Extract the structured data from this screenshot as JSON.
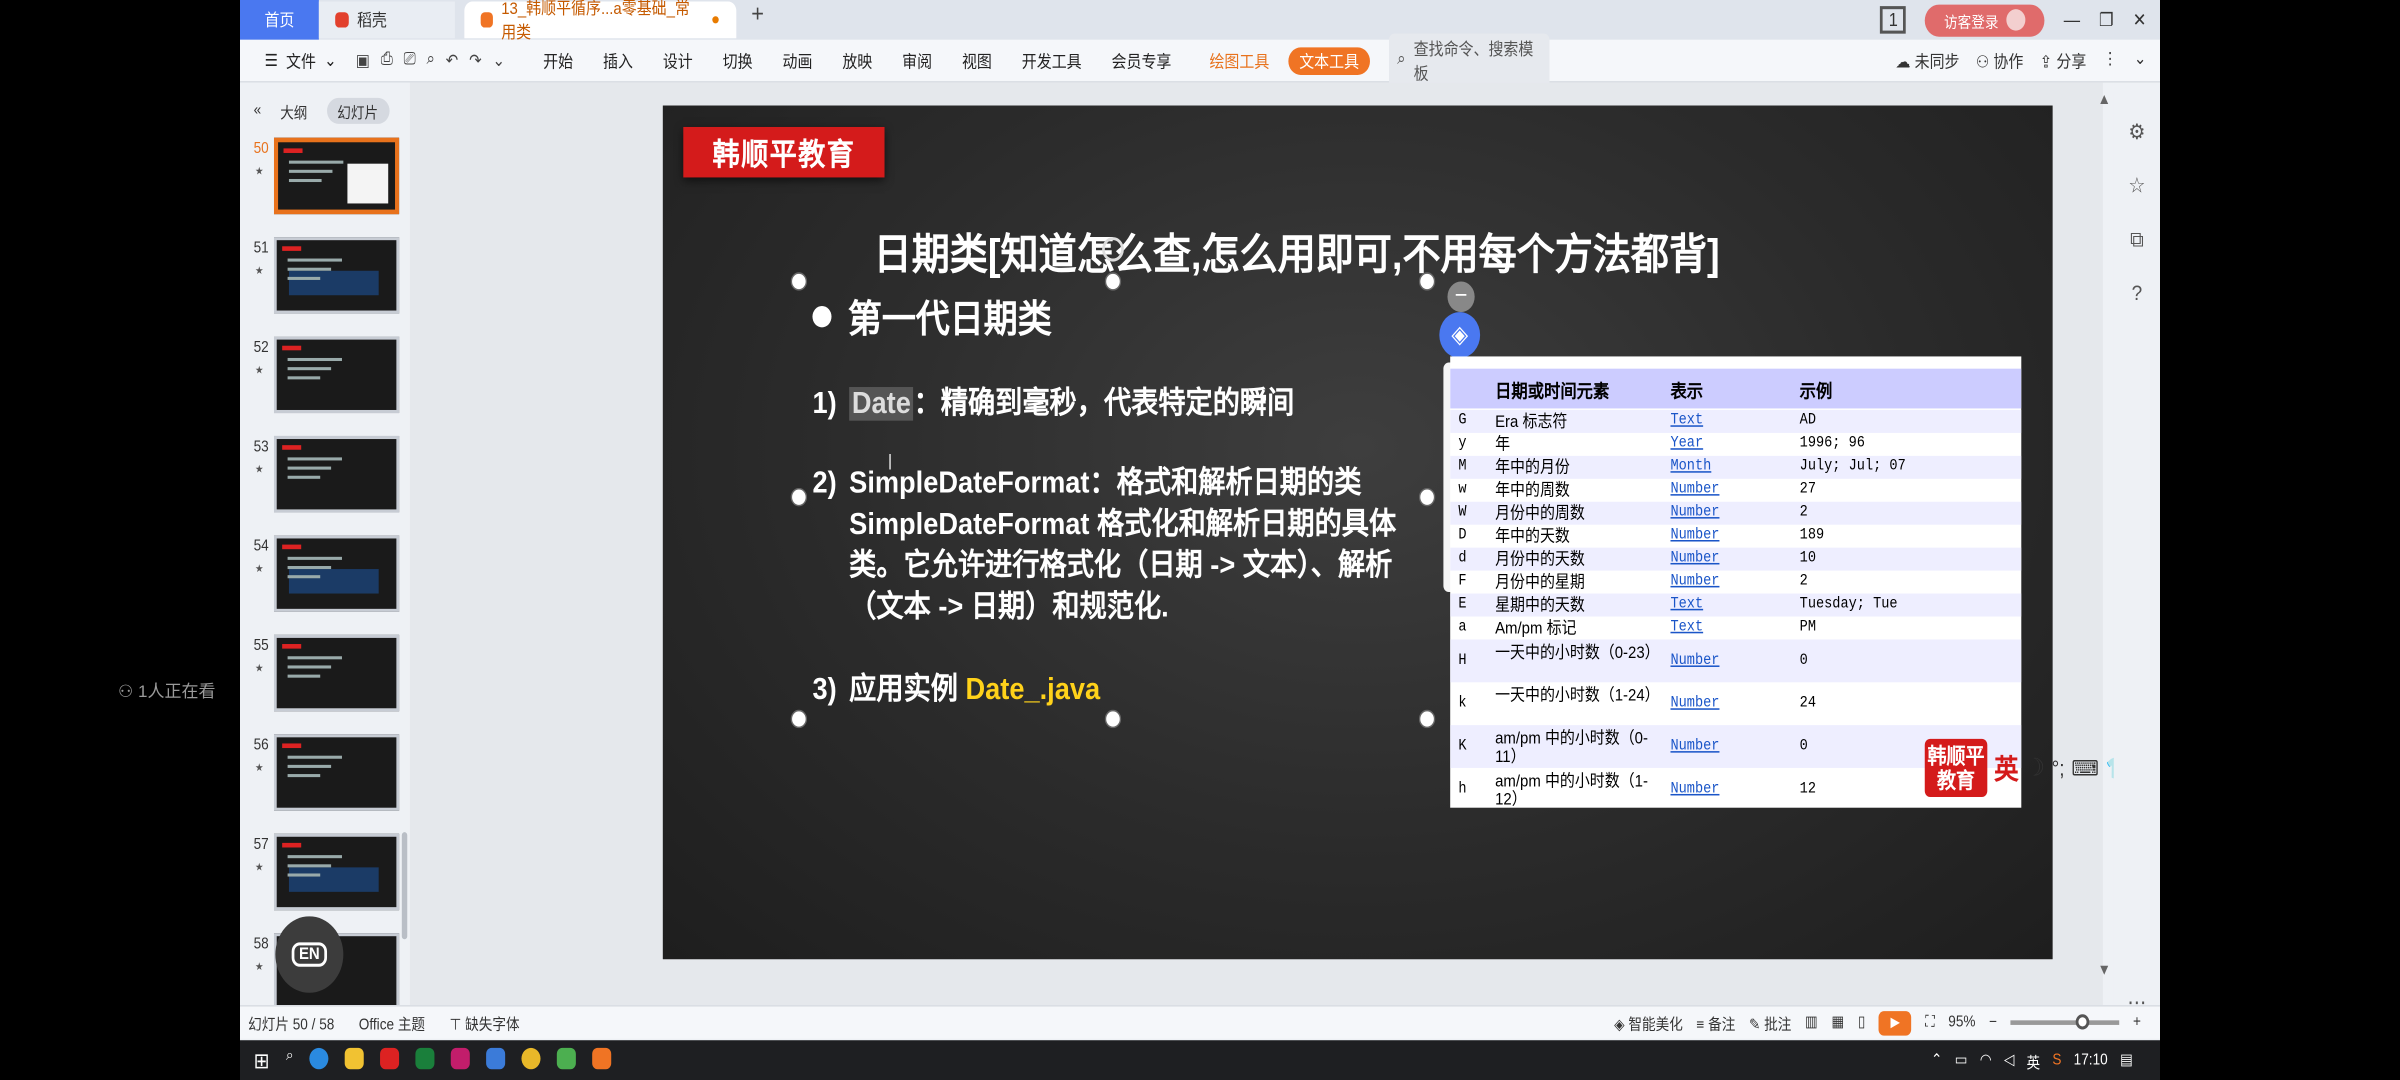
{
  "tabs": {
    "home": "首页",
    "daoke": "稻壳",
    "doc": "13_韩顺平循序...a零基础_常用类",
    "doc_dot": "●",
    "add": "+"
  },
  "window": {
    "badge": "1",
    "visitor_login": "访客登录",
    "min": "—",
    "max": "❐",
    "close": "✕"
  },
  "ribbon": {
    "file": "文件",
    "menu": [
      "开始",
      "插入",
      "设计",
      "切换",
      "动画",
      "放映",
      "审阅",
      "视图",
      "开发工具",
      "会员专享"
    ],
    "draw_tool": "绘图工具",
    "text_tool": "文本工具",
    "search_placeholder": "查找命令、搜索模板",
    "unsynced": "未同步",
    "collab": "协作",
    "share": "分享"
  },
  "leftpanel": {
    "outline": "大纲",
    "slides": "幻灯片",
    "thumb_numbers": [
      "50",
      "51",
      "52",
      "53",
      "54",
      "55",
      "56",
      "57",
      "58"
    ],
    "selected": "50",
    "en_button": "EN"
  },
  "slide": {
    "brand": "韩顺平教育",
    "title": "日期类[知道怎么查,怎么用即可,不用每个方法都背]",
    "heading": "第一代日期类",
    "items": [
      {
        "num": "1)",
        "highlight": "Date",
        "text": "：精确到毫秒，代表特定的瞬间"
      },
      {
        "num": "2)",
        "text": "SimpleDateFormat：格式和解析日期的类 SimpleDateFormat 格式化和解析日期的具体类。它允许进行格式化（日期 -> 文本）、解析（文本 -> 日期）和规范化."
      },
      {
        "num": "3)",
        "text": "应用实例 ",
        "yellow": "Date_.java"
      }
    ]
  },
  "table": {
    "headers": [
      "日期或时间元素",
      "表示",
      "示例"
    ],
    "rows": [
      {
        "letter": "G",
        "element": "Era 标志符",
        "type": "Text",
        "example": "AD"
      },
      {
        "letter": "y",
        "element": "年",
        "type": "Year",
        "example": "1996; 96"
      },
      {
        "letter": "M",
        "element": "年中的月份",
        "type": "Month",
        "example": "July; Jul; 07"
      },
      {
        "letter": "w",
        "element": "年中的周数",
        "type": "Number",
        "example": "27"
      },
      {
        "letter": "W",
        "element": "月份中的周数",
        "type": "Number",
        "example": "2"
      },
      {
        "letter": "D",
        "element": "年中的天数",
        "type": "Number",
        "example": "189"
      },
      {
        "letter": "d",
        "element": "月份中的天数",
        "type": "Number",
        "example": "10"
      },
      {
        "letter": "F",
        "element": "月份中的星期",
        "type": "Number",
        "example": "2"
      },
      {
        "letter": "E",
        "element": "星期中的天数",
        "type": "Text",
        "example": "Tuesday; Tue"
      },
      {
        "letter": "a",
        "element": "Am/pm 标记",
        "type": "Text",
        "example": "PM"
      },
      {
        "letter": "H",
        "element": "一天中的小时数（0-23）",
        "type": "Number",
        "example": "0"
      },
      {
        "letter": "k",
        "element": "一天中的小时数（1-24）",
        "type": "Number",
        "example": "24"
      },
      {
        "letter": "K",
        "element": "am/pm 中的小时数（0-11）",
        "type": "Number",
        "example": "0"
      },
      {
        "letter": "h",
        "element": "am/pm 中的小时数（1-12）",
        "type": "Number",
        "example": "12"
      }
    ]
  },
  "ime": {
    "logo": "韩顺平教育",
    "lang": "英",
    "moon": "☽",
    "punct": "°;"
  },
  "status": {
    "slide_pos": "幻灯片 50 / 58",
    "theme": "Office 主题",
    "missing_font": "缺失字体",
    "beautify": "智能美化",
    "notes": "备注",
    "comment": "批注",
    "zoom": "95%"
  },
  "taskbar": {
    "time": "17:10",
    "ime": "英",
    "watching": "1人正在看"
  },
  "colors": {
    "accent": "#f07424",
    "brand_red": "#d41b1b",
    "tab_blue": "#4a78f0"
  }
}
